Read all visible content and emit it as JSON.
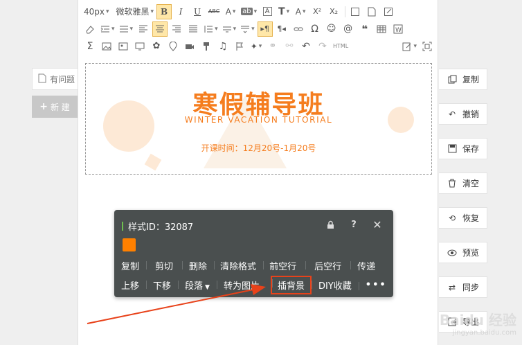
{
  "left_panel": {
    "item_label": "有问题",
    "new_label": "新 建"
  },
  "toolbar": {
    "font_size": "40px",
    "font_family": "微软雅黑",
    "row1_icons": [
      "bold-icon",
      "italic-icon",
      "underline-icon",
      "strikethrough-icon",
      "font-color-icon",
      "background-color-icon",
      "border-icon",
      "text-size-icon",
      "line-height-icon",
      "superscript-icon",
      "subscript-icon",
      "checkbox-icon",
      "new-doc-icon",
      "edit-icon"
    ],
    "row1_labels": {
      "bold": "B",
      "italic": "I",
      "underline": "U",
      "strike": "ABC",
      "fontcolor": "A",
      "bg": "ab",
      "border": "A",
      "tsize": "T",
      "lh": "A",
      "sup": "X²",
      "sub": "X₂"
    },
    "row3_html": "HTML"
  },
  "banner": {
    "title": "寒假辅导班",
    "subtitle": "WINTER VACATION TUTORIAL",
    "date": "开课时间：12月20号-1月20号"
  },
  "right_panel": {
    "items": [
      {
        "label": "复制",
        "icon": "copy-icon"
      },
      {
        "label": "撤销",
        "icon": "undo-icon"
      },
      {
        "label": "保存",
        "icon": "save-icon"
      },
      {
        "label": "清空",
        "icon": "trash-icon"
      },
      {
        "label": "恢复",
        "icon": "restore-icon"
      },
      {
        "label": "预览",
        "icon": "eye-icon"
      },
      {
        "label": "同步",
        "icon": "sync-icon"
      },
      {
        "label": "导出",
        "icon": "export-icon"
      }
    ]
  },
  "popup": {
    "style_id": "样式ID：32087",
    "swatch_color": "#ff8000",
    "row1": [
      "复制",
      "剪切",
      "删除",
      "清除格式",
      "前空行",
      "后空行",
      "传递"
    ],
    "row2": [
      "上移",
      "下移",
      "段落",
      "转为图片",
      "插背景",
      "DIY收藏",
      "•••"
    ],
    "highlight": "插背景"
  },
  "watermark": {
    "brand": "Baidu 经验",
    "url": "jingyan.baidu.com"
  },
  "colors": {
    "accent": "#f57d1e",
    "popup_bg": "#4a4f4f",
    "highlight_border": "#e8421a",
    "arrow": "#e8421a"
  }
}
